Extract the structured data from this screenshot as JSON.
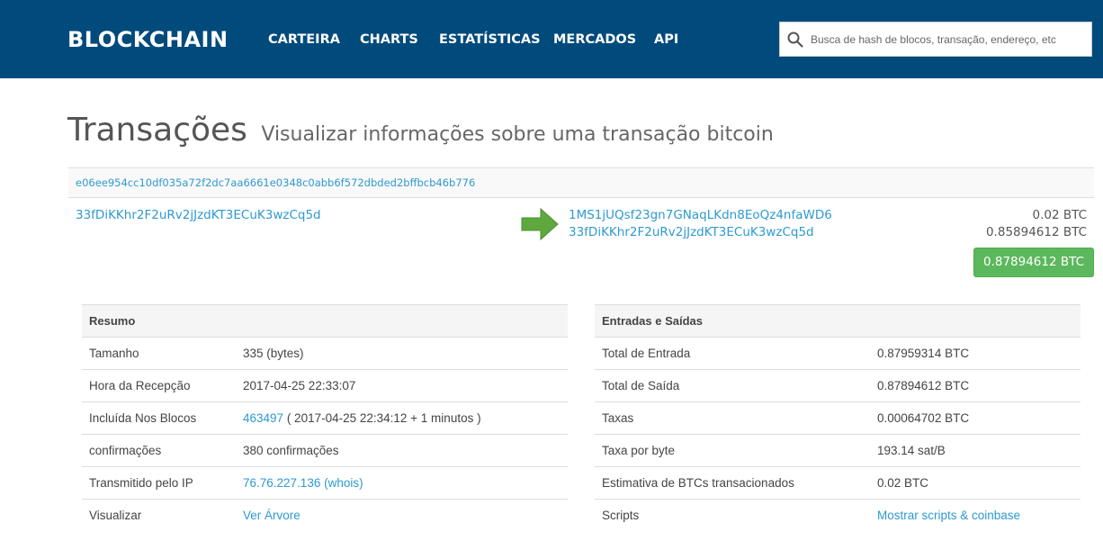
{
  "header": {
    "logo": "BLOCKCHAIN",
    "nav": [
      "CARTEIRA",
      "CHARTS",
      "ESTATÍSTICAS",
      "MERCADOS",
      "API"
    ],
    "search_placeholder": "Busca de hash de blocos, transação, endereço, etc"
  },
  "page": {
    "title": "Transações",
    "subtitle": "Visualizar informações sobre uma transação bitcoin"
  },
  "transaction": {
    "hash": "e06ee954cc10df035a72f2dc7aa6661e0348c0abb6f572dbded2bffbcb46b776",
    "input_address": "33fDiKKhr2F2uRv2jJzdKT3ECuK3wzCq5d",
    "outputs": [
      {
        "address": "1MS1jUQsf23gn7GNaqLKdn8EoQz4nfaWD6",
        "amount": "0.02 BTC"
      },
      {
        "address": "33fDiKKhr2F2uRv2jJzdKT3ECuK3wzCq5d",
        "amount": "0.85894612 BTC"
      }
    ],
    "total": "0.87894612 BTC"
  },
  "summary": {
    "heading": "Resumo",
    "rows": [
      {
        "label": "Tamanho",
        "value": "335 (bytes)"
      },
      {
        "label": "Hora da Recepção",
        "value": "2017-04-25 22:33:07"
      },
      {
        "label": "Incluída Nos Blocos",
        "link": "463497",
        "value": " ( 2017-04-25 22:34:12 + 1 minutos )"
      },
      {
        "label": "confirmações",
        "value": "380 confirmações"
      },
      {
        "label": "Transmitido pelo IP",
        "link": "76.76.227.136 (whois)"
      },
      {
        "label": "Visualizar",
        "link": "Ver Árvore"
      }
    ]
  },
  "io": {
    "heading": "Entradas e Saídas",
    "rows": [
      {
        "label": "Total de Entrada",
        "value": "0.87959314 BTC"
      },
      {
        "label": "Total de Saída",
        "value": "0.87894612 BTC"
      },
      {
        "label": "Taxas",
        "value": "0.00064702 BTC"
      },
      {
        "label": "Taxa por byte",
        "value": "193.14 sat/B"
      },
      {
        "label": "Estimativa de BTCs transacionados",
        "value": "0.02 BTC"
      },
      {
        "label": "Scripts",
        "link": "Mostrar scripts & coinbase"
      }
    ]
  },
  "colors": {
    "header_bg": "#004a7c",
    "link": "#2e9ad0",
    "success": "#5cb85c"
  }
}
